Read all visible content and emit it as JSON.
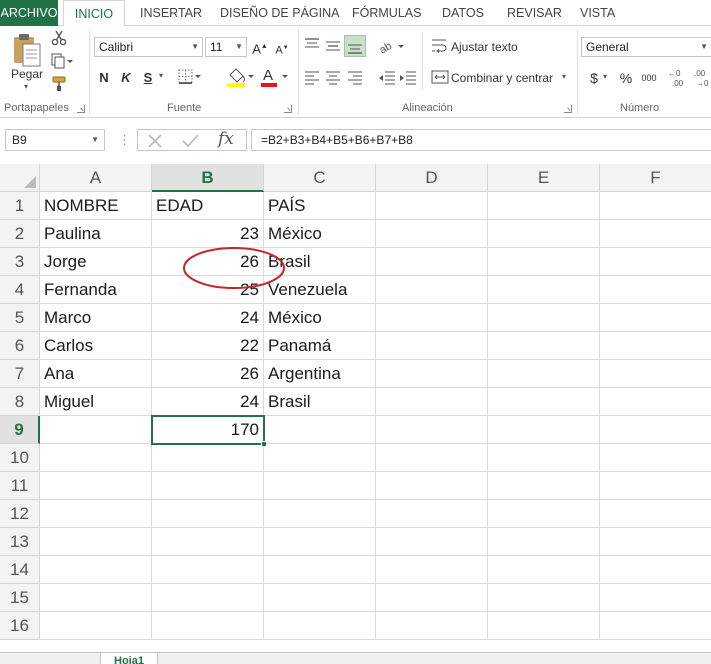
{
  "ribbon_tabs": [
    "ARCHIVO",
    "INICIO",
    "INSERTAR",
    "DISEÑO DE PÁGINA",
    "FÓRMULAS",
    "DATOS",
    "REVISAR",
    "VISTA"
  ],
  "clipboard": {
    "paste_label": "Pegar",
    "group_label": "Portapapeles"
  },
  "font": {
    "family": "Calibri",
    "size": "11",
    "bold": "N",
    "italic": "K",
    "underline": "S",
    "group_label": "Fuente"
  },
  "alignment": {
    "wrap_text": "Ajustar texto",
    "merge_center": "Combinar y centrar",
    "group_label": "Alineación"
  },
  "number": {
    "format": "General",
    "currency": "$",
    "percent": "%",
    "thousands": "000",
    "group_label": "Número"
  },
  "formula_bar": {
    "name_box": "B9",
    "fx": "fx",
    "formula": "=B2+B3+B4+B5+B6+B7+B8"
  },
  "columns": [
    "A",
    "B",
    "C",
    "D",
    "E",
    "F"
  ],
  "rows": [
    "1",
    "2",
    "3",
    "4",
    "5",
    "6",
    "7",
    "8",
    "9",
    "10",
    "11",
    "12",
    "13",
    "14",
    "15",
    "16"
  ],
  "cells": {
    "r1": {
      "a": "NOMBRE",
      "b": "EDAD",
      "c": "PAÍS"
    },
    "r2": {
      "a": "Paulina",
      "b": "23",
      "c": "México"
    },
    "r3": {
      "a": "Jorge",
      "b": "26",
      "c": "Brasil"
    },
    "r4": {
      "a": "Fernanda",
      "b": "25",
      "c": "Venezuela"
    },
    "r5": {
      "a": "Marco",
      "b": "24",
      "c": "México"
    },
    "r6": {
      "a": "Carlos",
      "b": "22",
      "c": "Panamá"
    },
    "r7": {
      "a": "Ana",
      "b": "26",
      "c": "Argentina"
    },
    "r8": {
      "a": "Miguel",
      "b": "24",
      "c": "Brasil"
    },
    "r9": {
      "b": "170"
    }
  },
  "selected_cell": "B9",
  "sheet_tab": "Hoja1",
  "colors": {
    "accent": "#217346",
    "annotation": "#c0282d",
    "font_color": "#e81123",
    "highlight": "#ffff00"
  }
}
